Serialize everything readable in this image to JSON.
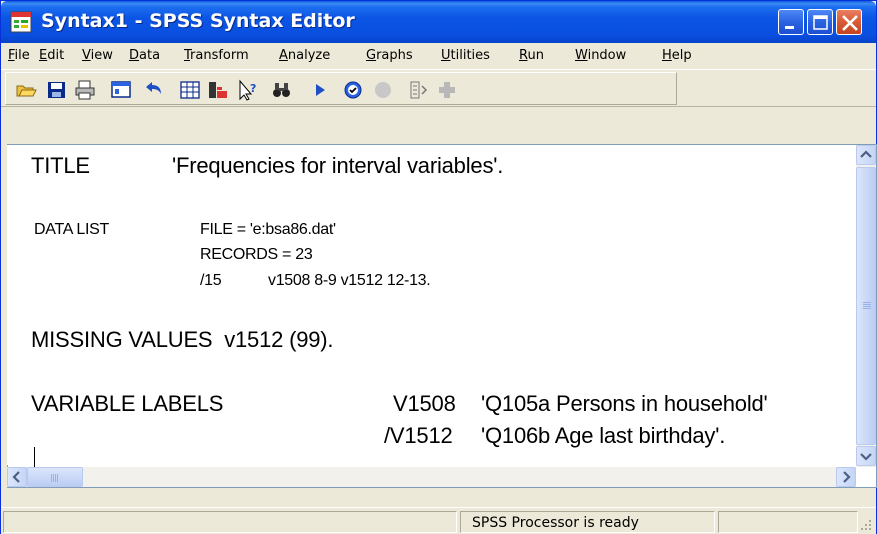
{
  "window": {
    "title": "Syntax1 - SPSS Syntax Editor"
  },
  "menu": [
    {
      "pre": "",
      "key": "F",
      "post": "ile"
    },
    {
      "pre": "",
      "key": "E",
      "post": "dit"
    },
    {
      "pre": "",
      "key": "V",
      "post": "iew"
    },
    {
      "pre": "",
      "key": "D",
      "post": "ata"
    },
    {
      "pre": "",
      "key": "T",
      "post": "ransform"
    },
    {
      "pre": "",
      "key": "A",
      "post": "nalyze"
    },
    {
      "pre": "",
      "key": "G",
      "post": "raphs"
    },
    {
      "pre": "",
      "key": "U",
      "post": "tilities"
    },
    {
      "pre": "",
      "key": "R",
      "post": "un"
    },
    {
      "pre": "",
      "key": "W",
      "post": "indow"
    },
    {
      "pre": "",
      "key": "H",
      "post": "elp"
    }
  ],
  "toolbar": {
    "icons": [
      "open-icon",
      "save-icon",
      "print-icon",
      "dialog-recall-icon",
      "undo-icon",
      "data-editor-icon",
      "variables-icon",
      "help-icon",
      "find-icon",
      "run-icon",
      "spell-icon",
      "designate-icon",
      "syntax-icon",
      "add-icon"
    ]
  },
  "editor": {
    "lines": {
      "title_kw": "TITLE",
      "title_val": "'Frequencies for interval variables'.",
      "datalist_kw": "DATA LIST",
      "datalist_file": "FILE = 'e:bsa86.dat'",
      "datalist_records": "RECORDS = 23",
      "datalist_rec_num": "/15",
      "datalist_vars": "v1508 8-9 v1512 12-13.",
      "missing": "MISSING VALUES  v1512 (99).",
      "varlabels_kw": "VARIABLE LABELS",
      "v1_name": "V1508",
      "v1_label": "'Q105a Persons in household'",
      "v2_name": "/V1512",
      "v2_label": "'Q106b Age last birthday'."
    }
  },
  "status": {
    "text": "SPSS Processor is ready"
  },
  "colors": {
    "titlebar": "#0a4fe0",
    "close_button": "#d85a35",
    "window_bg": "#ece9d8"
  }
}
